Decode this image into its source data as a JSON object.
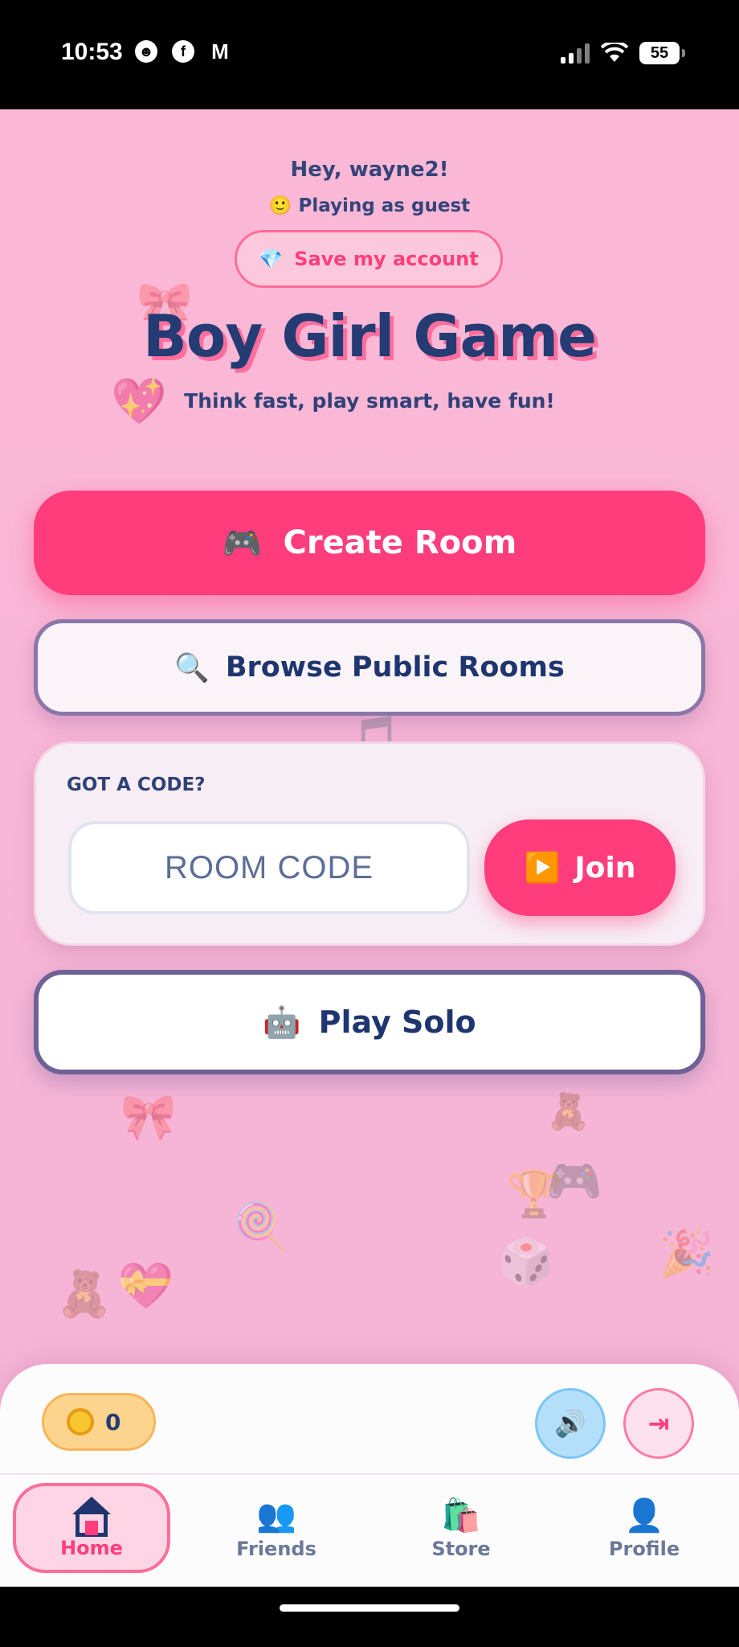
{
  "status_bar": {
    "time": "10:53",
    "app_icons": [
      "discord-icon",
      "facebook-icon",
      "gmail-icon"
    ],
    "battery": "55"
  },
  "header": {
    "greeting": "Hey, wayne2!",
    "guest_emoji": "🙂",
    "guest_text": "Playing as guest",
    "save_icon": "💎",
    "save_label": "Save my account",
    "title": "Boy Girl Game",
    "tagline": "Think fast, play smart, have fun!"
  },
  "actions": {
    "create_icon": "🎮",
    "create_label": "Create Room",
    "browse_icon": "🔍",
    "browse_label": "Browse Public Rooms",
    "code_label": "GOT A CODE?",
    "code_placeholder": "ROOM CODE",
    "code_value": "",
    "join_icon": "▶️",
    "join_label": "Join",
    "solo_icon": "🤖",
    "solo_label": "Play Solo"
  },
  "bottom_bar": {
    "coins": "0",
    "sound_icon": "🔊",
    "logout_icon": "⇥"
  },
  "nav": {
    "items": [
      {
        "label": "Home",
        "icon": "home-icon",
        "glyph": "",
        "active": true
      },
      {
        "label": "Friends",
        "icon": "friends-icon",
        "glyph": "👥",
        "active": false
      },
      {
        "label": "Store",
        "icon": "store-icon",
        "glyph": "🛍️",
        "active": false
      },
      {
        "label": "Profile",
        "icon": "profile-icon",
        "glyph": "👤",
        "active": false
      }
    ]
  },
  "colors": {
    "background": "#fbb8d6",
    "accent": "#ff3d7c",
    "navy": "#1e3570"
  }
}
